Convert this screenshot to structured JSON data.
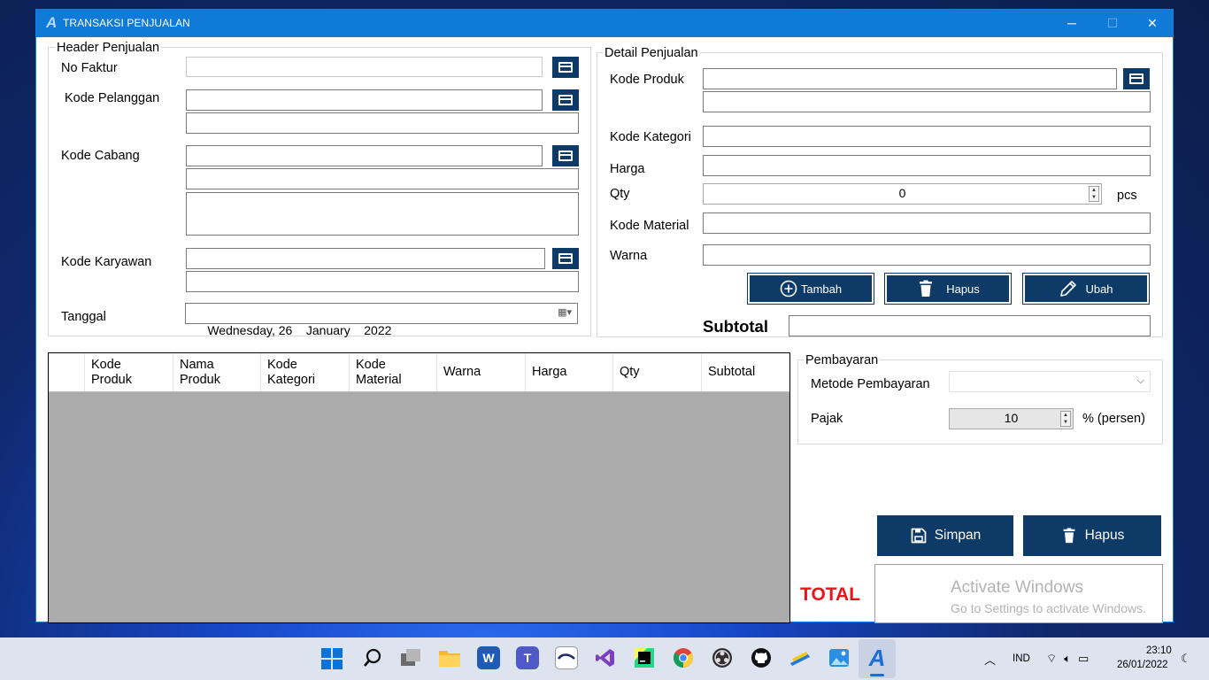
{
  "window": {
    "title": "TRANSAKSI PENJUALAN",
    "app_icon_letter": "A",
    "controls": {
      "minimize": "─",
      "maximize": "☐",
      "close": "✕"
    }
  },
  "header_group": {
    "title": "Header Penjualan",
    "no_faktur_label": "No Faktur",
    "kode_pelanggan_label": "Kode Pelanggan",
    "kode_cabang_label": "Kode Cabang",
    "kode_karyawan_label": "Kode Karyawan",
    "tanggal_label": "Tanggal",
    "tanggal_value": "Wednesday, 26    January    2022"
  },
  "detail_group": {
    "title": "Detail Penjualan",
    "kode_produk_label": "Kode Produk",
    "kode_kategori_label": "Kode Kategori",
    "harga_label": "Harga",
    "qty_label": "Qty",
    "qty_value": "0",
    "qty_unit": "pcs",
    "kode_material_label": "Kode Material",
    "warna_label": "Warna",
    "tambah_label": "Tambah",
    "hapus_label": "Hapus",
    "ubah_label": "Ubah",
    "subtotal_label": "Subtotal"
  },
  "grid": {
    "columns": [
      "Kode\nProduk",
      "Nama\nProduk",
      "Kode\nKategori",
      "Kode\nMaterial",
      "Warna",
      "Harga",
      "Qty",
      "Subtotal"
    ]
  },
  "payment_group": {
    "title": "Pembayaran",
    "metode_label": "Metode Pembayaran",
    "metode_value": "",
    "pajak_label": "Pajak",
    "pajak_value": "10",
    "pajak_unit": "% (persen)"
  },
  "actions": {
    "simpan_label": "Simpan",
    "hapus_label": "Hapus"
  },
  "total": {
    "label": "TOTAL",
    "watermark_title": "Activate Windows",
    "watermark_sub": "Go to Settings to activate Windows."
  },
  "taskbar": {
    "language": "IND",
    "time": "23:10",
    "date": "26/01/2022"
  },
  "colors": {
    "titlebar": "#0f7ad8",
    "button_navy": "#0e3a67",
    "total_red": "#e8141a"
  }
}
